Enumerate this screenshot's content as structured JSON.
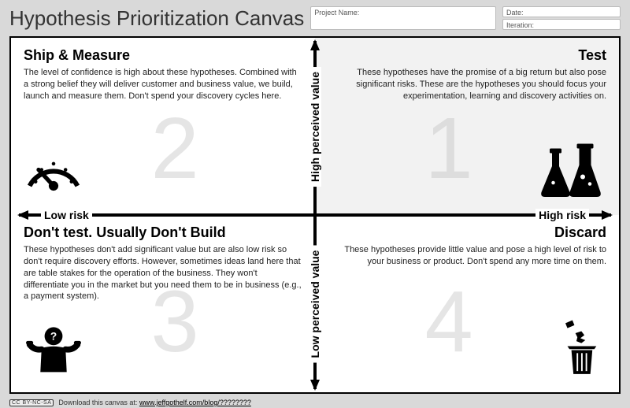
{
  "title": "Hypothesis Prioritization Canvas",
  "fields": {
    "project_label": "Project Name:",
    "date_label": "Date:",
    "iteration_label": "Iteration:"
  },
  "axes": {
    "x_low": "Low risk",
    "x_high": "High risk",
    "y_high": "High perceived value",
    "y_low": "Low perceived value"
  },
  "quadrants": {
    "tl": {
      "num": "2",
      "title": "Ship & Measure",
      "body": "The level of confidence is high about these hypotheses. Combined with a strong belief they will deliver customer and business value, we build, launch and measure them. Don't spend your discovery cycles here."
    },
    "tr": {
      "num": "1",
      "title": "Test",
      "body": "These hypotheses have the promise of a big return but also pose significant risks. These are the hypotheses you should focus your experimentation, learning and discovery activities on."
    },
    "bl": {
      "num": "3",
      "title": "Don't test. Usually Don't Build",
      "body": "These hypotheses don't add significant value but are also low risk so don't require discovery efforts. However, sometimes ideas land here that are table stakes for the operation of the business. They won't differentiate you in the market but you need them to be in business (e.g., a payment system)."
    },
    "br": {
      "num": "4",
      "title": "Discard",
      "body": "These hypotheses provide little value and pose a high level of risk to your business or product. Don't spend any more time on them."
    }
  },
  "footer": {
    "cc": "CC BY-NC-SA",
    "text": "Download this canvas at: ",
    "link": "www.jeffgothelf.com/blog/????????"
  }
}
